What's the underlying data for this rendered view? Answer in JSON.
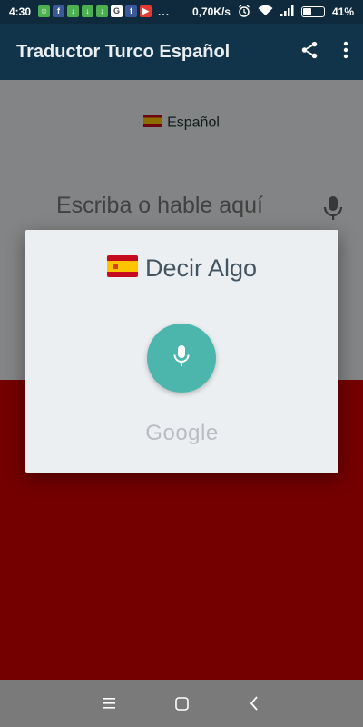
{
  "status_bar": {
    "time": "4:30",
    "speed": "0,70K/s",
    "battery": "41%",
    "battery_fraction": 0.41,
    "more": "...",
    "notification_icons": [
      "android-icon",
      "facebook-icon",
      "download-icon",
      "download-icon",
      "download-icon",
      "google-icon",
      "facebook-icon",
      "youtube-icon"
    ]
  },
  "app_bar": {
    "title": "Traductor Turco Español"
  },
  "main": {
    "language_label": "Español",
    "input_placeholder": "Escriba o hable aquí"
  },
  "dialog": {
    "title": "Decir Algo",
    "google_label": "Google"
  },
  "colors": {
    "app_bar": "#12344a",
    "status_bar": "#0f2a3c",
    "mic_button": "#4db6ac",
    "flag_red": "#c60b1e",
    "flag_yellow": "#ffc400",
    "bottom_panel": "#d30000"
  }
}
